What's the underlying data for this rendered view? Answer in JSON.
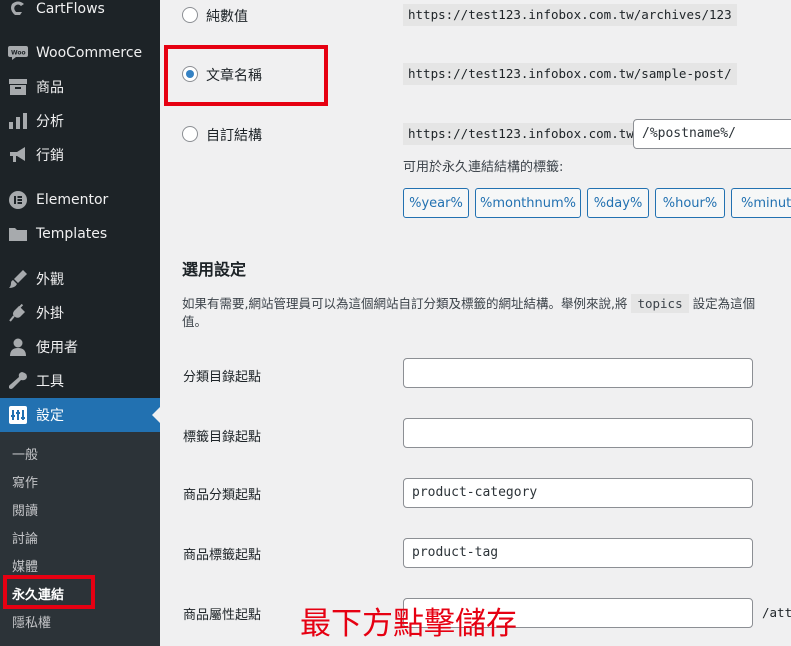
{
  "sidebar": {
    "menu": [
      {
        "name": "menu-cartflows",
        "icon": "cartflows-icon",
        "label": "CartFlows"
      },
      {
        "name": "menu-woocommerce",
        "icon": "woocommerce-icon",
        "label": "WooCommerce"
      },
      {
        "name": "menu-products",
        "icon": "products-icon",
        "label": "商品"
      },
      {
        "name": "menu-analytics",
        "icon": "analytics-icon",
        "label": "分析"
      },
      {
        "name": "menu-marketing",
        "icon": "marketing-icon",
        "label": "行銷"
      },
      {
        "name": "menu-elementor",
        "icon": "elementor-icon",
        "label": "Elementor"
      },
      {
        "name": "menu-templates",
        "icon": "folder-icon",
        "label": "Templates"
      },
      {
        "name": "menu-appearance",
        "icon": "appearance-icon",
        "label": "外觀"
      },
      {
        "name": "menu-plugins",
        "icon": "plugins-icon",
        "label": "外掛"
      },
      {
        "name": "menu-users",
        "icon": "users-icon",
        "label": "使用者"
      },
      {
        "name": "menu-tools",
        "icon": "tools-icon",
        "label": "工具"
      },
      {
        "name": "menu-settings",
        "icon": "settings-icon",
        "label": "設定"
      }
    ],
    "submenu": [
      {
        "label": "一般"
      },
      {
        "label": "寫作"
      },
      {
        "label": "閱讀"
      },
      {
        "label": "討論"
      },
      {
        "label": "媒體"
      },
      {
        "label": "永久連結"
      },
      {
        "label": "隱私權"
      }
    ],
    "active_submenu": "永久連結"
  },
  "permalink_options": [
    {
      "label": "純數值",
      "example": "https://test123.infobox.com.tw/archives/123",
      "checked": false
    },
    {
      "label": "文章名稱",
      "example": "https://test123.infobox.com.tw/sample-post/",
      "checked": true
    },
    {
      "label": "自訂結構",
      "example": "https://test123.infobox.com.tw",
      "value": "/%postname%/",
      "checked": false
    }
  ],
  "tags": {
    "caption": "可用於永久連結結構的標籤:",
    "items": [
      "%year%",
      "%monthnum%",
      "%day%",
      "%hour%",
      "%minute"
    ]
  },
  "optional": {
    "title": "選用設定",
    "desc_before": "如果有需要,網站管理員可以為這個網站自訂分類及標籤的網址結構。舉例來說,將",
    "desc_code": "topics",
    "desc_after": "設定為這個",
    "desc_line2": "值。",
    "fields": [
      {
        "label": "分類目錄起點",
        "value": ""
      },
      {
        "label": "標籤目錄起點",
        "value": ""
      },
      {
        "label": "商品分類起點",
        "value": "product-category"
      },
      {
        "label": "商品標籤起點",
        "value": "product-tag"
      },
      {
        "label": "商品屬性起點",
        "value": "",
        "suffix": "/att"
      }
    ]
  },
  "annotation": {
    "note": "最下方點擊儲存",
    "color": "#e60012"
  },
  "colors": {
    "sidebar_bg": "#1d2327",
    "active": "#2271b1",
    "highlight": "#e60012"
  }
}
